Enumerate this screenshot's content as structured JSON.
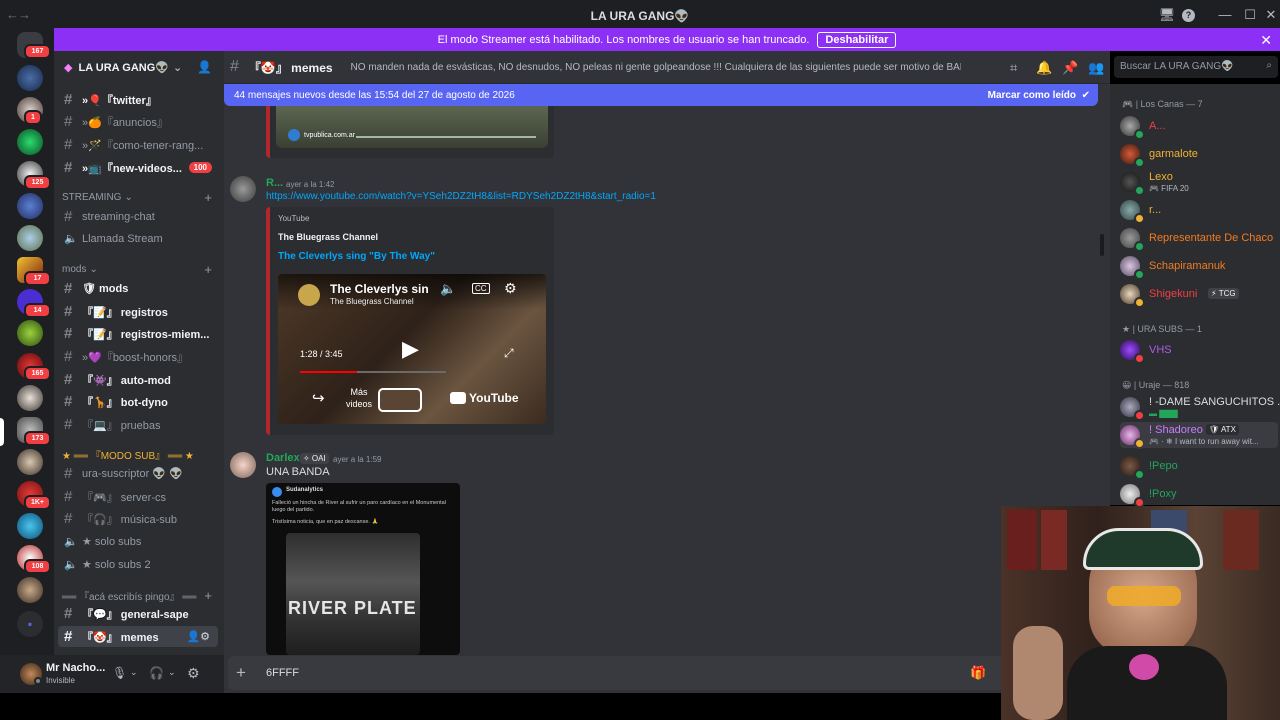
{
  "window": {
    "title": "LA URA GANG👽",
    "nav_back": "←",
    "nav_forward": "→",
    "controls": [
      "🖥",
      "?",
      "—",
      "☐",
      "✕"
    ]
  },
  "banner": {
    "text": "El modo Streamer está habilitado. Los nombres de usuario se han truncado.",
    "button": "Deshabilitar"
  },
  "rail": {
    "badges": [
      "167",
      "1",
      "125",
      "17",
      "14",
      "165",
      "173",
      "1K+",
      "108"
    ]
  },
  "guild": {
    "name": "LA URA GANG👽"
  },
  "channels": [
    {
      "name": "»🎈『twitter』",
      "unread": true,
      "type": "text"
    },
    {
      "name": "»🍊『anuncios』",
      "unread": false,
      "type": "text"
    },
    {
      "name": "»🪄『como-tener-rang...",
      "unread": false,
      "type": "text"
    },
    {
      "name": "»📺『new-videos...",
      "unread": true,
      "type": "text",
      "badge": "100"
    }
  ],
  "categories": {
    "streaming": "STREAMING",
    "mods": "mods",
    "modo_sub": "★ ══ 『MODO SUB』 ══ ★",
    "aca": "══ 『acá escribís pingo』 ══"
  },
  "streaming_channels": [
    {
      "name": "streaming-chat",
      "type": "text"
    },
    {
      "name": "Llamada Stream",
      "type": "voice"
    }
  ],
  "mods_channels": [
    {
      "name": "🛡 mods",
      "type": "text",
      "unread": true
    },
    {
      "name": "『📝』 registros",
      "type": "text",
      "unread": true
    },
    {
      "name": "『📝』 registros-miem...",
      "type": "text",
      "unread": true
    },
    {
      "name": "»💜『boost-honors』",
      "type": "text",
      "unread": false
    },
    {
      "name": "『👾』 auto-mod",
      "type": "text",
      "unread": true
    },
    {
      "name": "『🦒』 bot-dyno",
      "type": "text",
      "unread": true
    },
    {
      "name": "『💻』 pruebas",
      "type": "text",
      "unread": false
    }
  ],
  "sub_channels": [
    {
      "name": "ura-suscriptor 👽 👽",
      "type": "text",
      "unread": false
    },
    {
      "name": "『🎮』 server-cs",
      "type": "text",
      "unread": false
    },
    {
      "name": "『🎧』 música-sub",
      "type": "text",
      "unread": false
    },
    {
      "name": "★ solo subs",
      "type": "voice",
      "unread": false
    },
    {
      "name": "★ solo subs 2",
      "type": "voice",
      "unread": false
    }
  ],
  "aca_channels": [
    {
      "name": "『💬』 general-sape",
      "type": "text",
      "unread": true
    },
    {
      "name": "『🤡』 memes",
      "type": "text",
      "unread": true,
      "active": true
    }
  ],
  "user": {
    "name": "Mr Nacho...",
    "status": "Invisible"
  },
  "header": {
    "channel": "『🤡』 memes",
    "topic": "NO manden nada de esvásticas, NO desnudos, NO peleas ni gente golpeandose !!! Cualquiera de las siguientes puede ser motivo de BAN, cuiden el stream!",
    "search_placeholder": "Buscar LA URA GANG👽"
  },
  "new_messages": {
    "text": "44 mensajes nuevos desde las 15:54 del 27 de agosto de 2026",
    "mark": "Marcar como leído"
  },
  "messages": [
    {
      "author": "R...",
      "time": "ayer a la 1:42",
      "link": "https://www.youtube.com/watch?v=YSeh2DZ2tH8&list=RDYSeh2DZ2tH8&start_radio=1",
      "embed": {
        "provider": "YouTube",
        "channel": "The Bluegrass Channel",
        "title": "The Cleverlys sing \"By The Way\"",
        "video_title": "The Cleverlys sin",
        "video_sub": "The Bluegrass Channel",
        "timecode": "1:28 / 3:45",
        "more": "Más videos",
        "yt": "YouTube",
        "progress": 0.39
      }
    },
    {
      "author": "Darlex",
      "tag": "✧ OAI",
      "time": "ayer a la 1:59",
      "text": "UNA BANDA",
      "tweet_handle": "Sudanalytics",
      "tweet_text": "Falleció un hincha de River al sufrir un paro cardíaco en el Monumental luego del partido.",
      "tweet_text2": "Tristísima noticia, que en paz descanse. 🙏",
      "image_text": "RIVER PLATE"
    }
  ],
  "previous_embed": {
    "source": "tvpublica.com.ar"
  },
  "composer": {
    "value": "6FFFF"
  },
  "members": {
    "groups": [
      {
        "label": "🎮 | Los Canas — 7"
      },
      {
        "label": "★ | URA SUBS — 1"
      },
      {
        "label": "😀 | Uraje — 818"
      }
    ],
    "list": [
      {
        "name": "A...",
        "color": "#f23f43",
        "status": "#23a55a",
        "group": 0
      },
      {
        "name": "garmalote",
        "color": "#f0b232",
        "status": "#23a55a",
        "group": 0
      },
      {
        "name": "Lexo",
        "color": "#f0b232",
        "status": "#23a55a",
        "activity": "🎮 FIFA 20",
        "group": 0
      },
      {
        "name": "r...",
        "color": "#f0b232",
        "status": "#f0b232",
        "group": 0
      },
      {
        "name": "Representante De Chaco",
        "color": "#f47b20",
        "status": "#23a55a",
        "group": 0
      },
      {
        "name": "Schapiramanuk",
        "color": "#f47b20",
        "status": "#23a55a",
        "group": 0
      },
      {
        "name": "Shigekuni",
        "color": "#f23f43",
        "status": "#f0b232",
        "tag": "⚡ TCG",
        "group": 0
      },
      {
        "name": "VHS",
        "color": "#b05ce6",
        "status": "#f23f43",
        "group": 1
      },
      {
        "name": "! -DAME SANGUCHITOS ...",
        "color": "#dbdee1",
        "status": "#f23f43",
        "activity": "▬ ▇▇▇",
        "group": 2
      },
      {
        "name": "! Shadoreo",
        "color": "#c77dff",
        "status": "#f0b232",
        "tag": "🛡 ATX",
        "activity": "🎮 · ❄ I want to run away wit...",
        "group": 2
      },
      {
        "name": "!Pepo",
        "color": "#23a55a",
        "status": "#23a55a",
        "group": 2
      },
      {
        "name": "!Poxy",
        "color": "#23a55a",
        "status": "#f23f43",
        "group": 2
      }
    ]
  },
  "colors": {
    "banner": "#8d30f5",
    "blurple": "#5865f2",
    "link": "#00a8fc",
    "embed_border": "#b3262c"
  }
}
